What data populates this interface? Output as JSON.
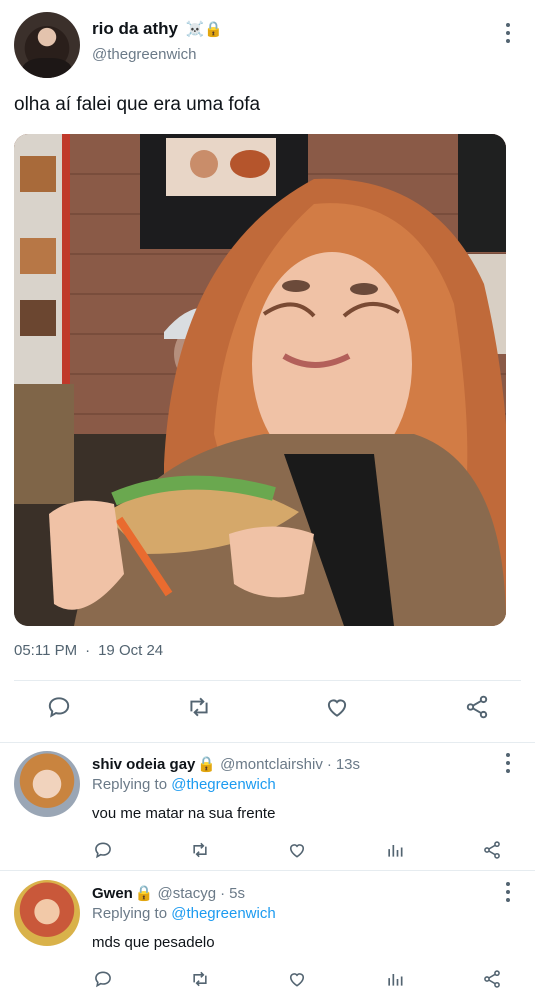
{
  "tweet": {
    "author_name": "rio da athy",
    "badges": "☠️🔒",
    "handle": "@thegreenwich",
    "text": "olha aí falei que era uma fofa",
    "time": "05:11 PM",
    "date": "19 Oct 24",
    "more_icon": "more-vertical-icon"
  },
  "actions": [
    "reply-icon",
    "retweet-icon",
    "like-icon",
    "share-icon"
  ],
  "replies": [
    {
      "name": "shiv odeia gay",
      "lock": "🔒",
      "handle": "@montclairshiv",
      "separator": "·",
      "time": "13s",
      "replying_prefix": "Replying to",
      "replying_to": "@thegreenwich",
      "text": "vou me matar na sua frente"
    },
    {
      "name": "Gwen",
      "lock": "🔒",
      "handle": "@stacyg",
      "separator": "·",
      "time": "5s",
      "replying_prefix": "Replying to",
      "replying_to": "@thegreenwich",
      "text": "mds que pesadelo"
    }
  ],
  "reply_actions": [
    "reply-icon",
    "retweet-icon",
    "like-icon",
    "analytics-icon",
    "share-icon"
  ],
  "colors": {
    "link": "#1d9bf0",
    "muted": "#536471",
    "text": "#0f1419",
    "divider": "#e6ecf0"
  }
}
